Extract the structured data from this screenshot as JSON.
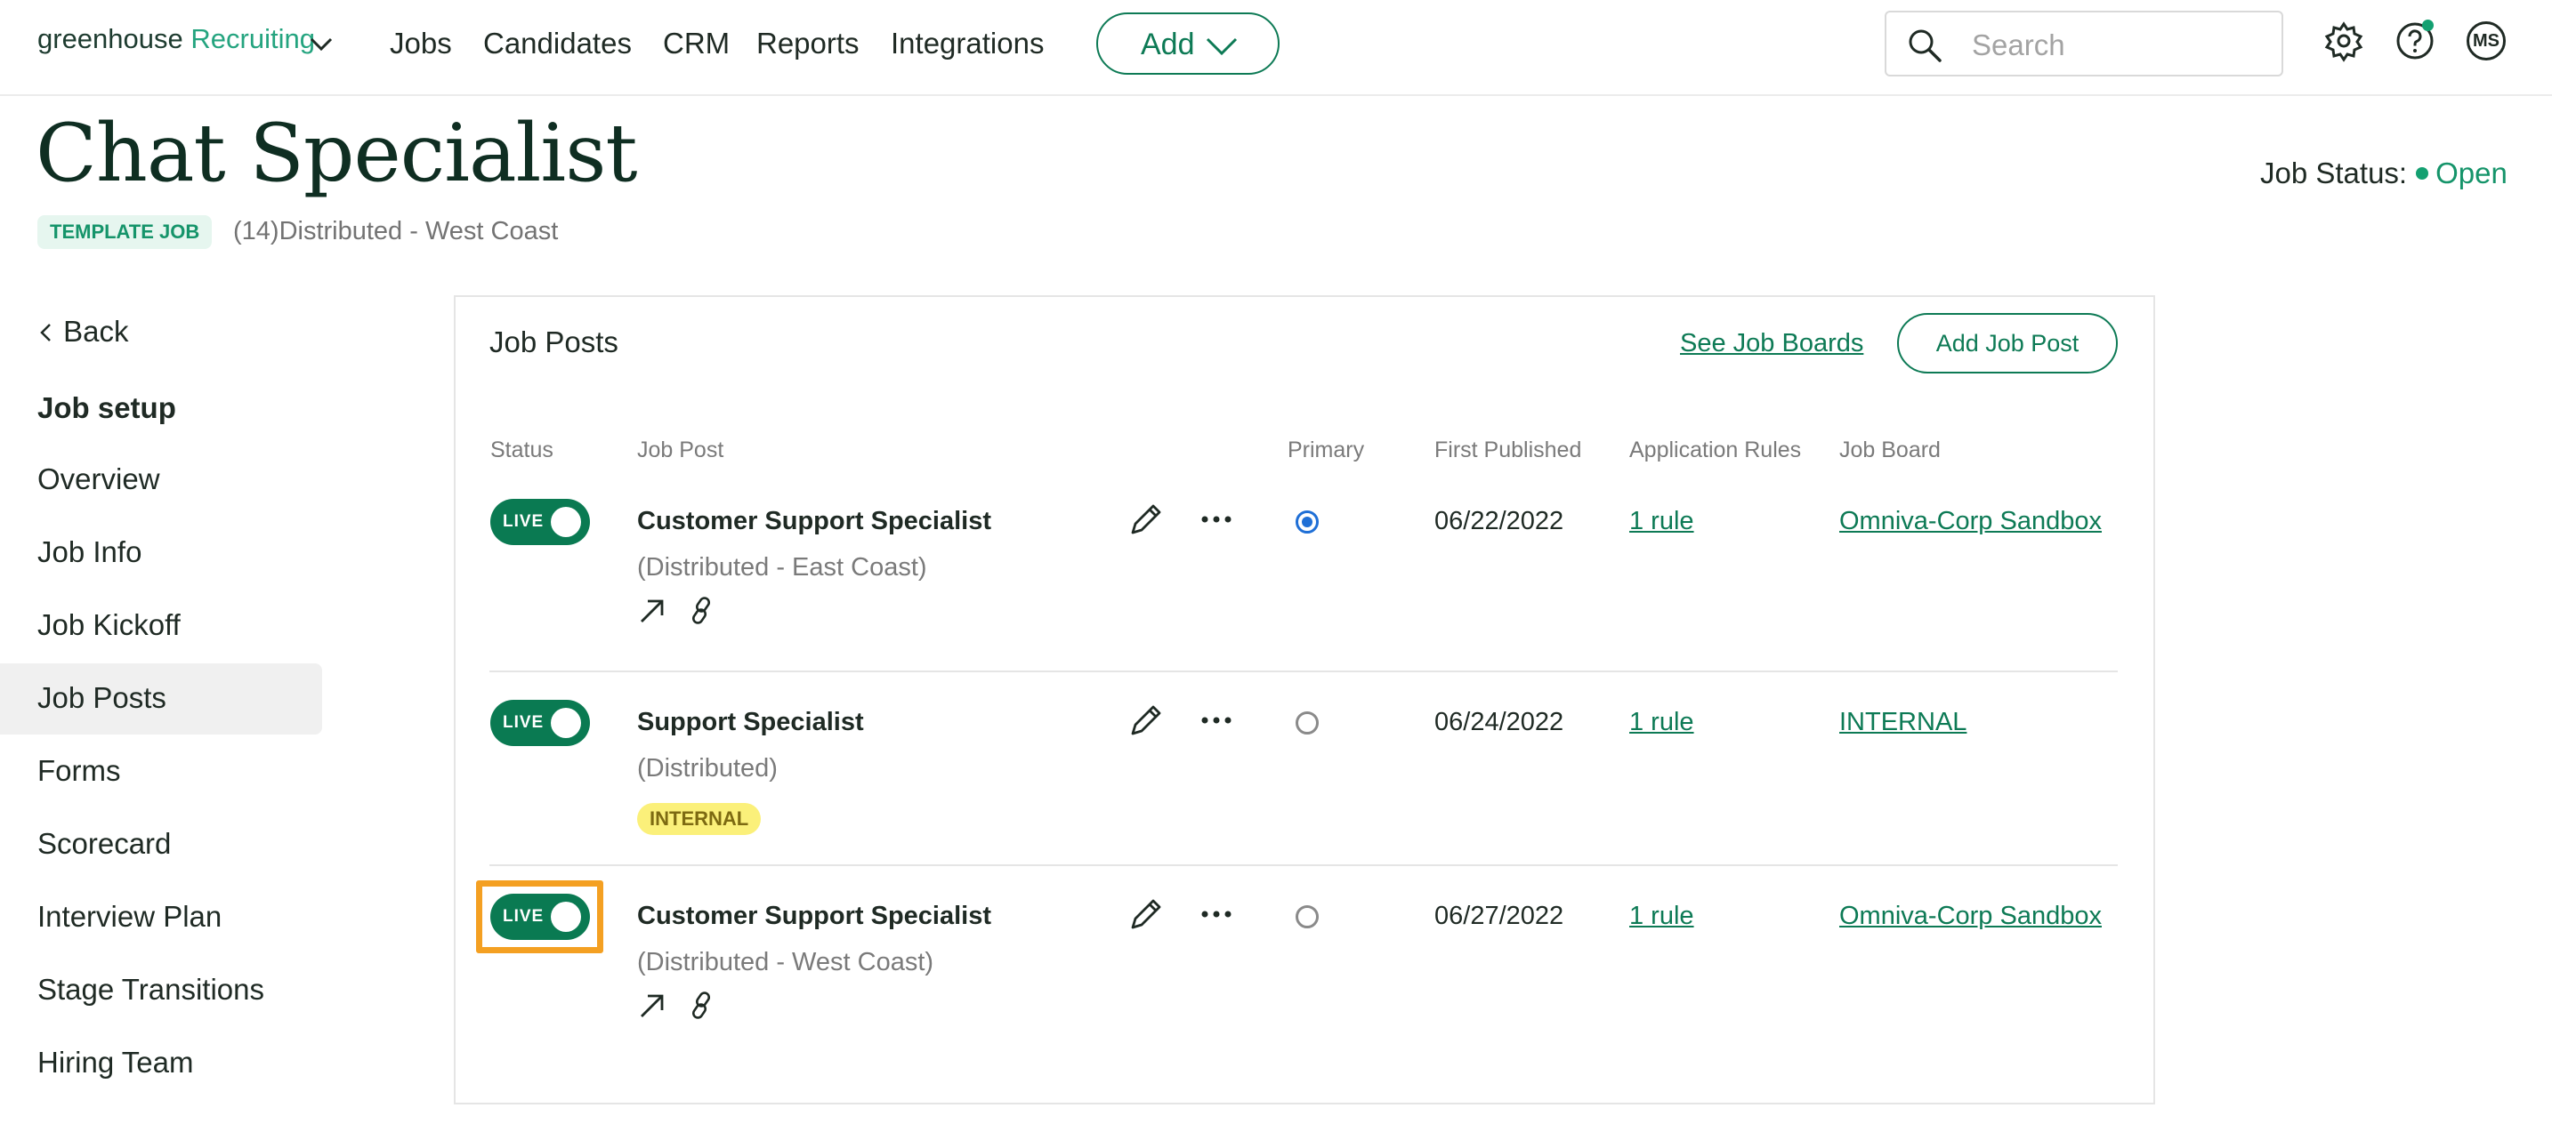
{
  "nav": {
    "logo_main": "greenhouse",
    "logo_accent": "Recruiting",
    "links": [
      "Jobs",
      "Candidates",
      "CRM",
      "Reports",
      "Integrations"
    ],
    "add_label": "Add",
    "search_placeholder": "Search",
    "avatar_initials": "MS"
  },
  "header": {
    "title": "Chat Specialist",
    "template_badge": "TEMPLATE JOB",
    "meta": "(14)Distributed - West Coast",
    "status_label": "Job Status:",
    "status_value": "Open"
  },
  "sidebar": {
    "back_label": "Back",
    "section_title": "Job setup",
    "items": [
      "Overview",
      "Job Info",
      "Job Kickoff",
      "Job Posts",
      "Forms",
      "Scorecard",
      "Interview Plan",
      "Stage Transitions",
      "Hiring Team"
    ],
    "active_item": "Job Posts"
  },
  "panel": {
    "title": "Job Posts",
    "see_boards": "See Job Boards",
    "add_post": "Add Job Post",
    "columns": {
      "status": "Status",
      "job_post": "Job Post",
      "primary": "Primary",
      "first_published": "First Published",
      "application_rules": "Application Rules",
      "job_board": "Job Board"
    },
    "rows": [
      {
        "status": "LIVE",
        "title": "Customer Support Specialist",
        "location": "(Distributed - East Coast)",
        "badge": "",
        "primary": true,
        "first_published": "06/22/2022",
        "rules": "1 rule",
        "board": "Omniva-Corp Sandbox"
      },
      {
        "status": "LIVE",
        "title": "Support Specialist",
        "location": "(Distributed)",
        "badge": "INTERNAL",
        "primary": false,
        "first_published": "06/24/2022",
        "rules": "1 rule",
        "board": "INTERNAL"
      },
      {
        "status": "LIVE",
        "title": "Customer Support Specialist",
        "location": "(Distributed - West Coast)",
        "badge": "",
        "primary": false,
        "first_published": "06/27/2022",
        "rules": "1 rule",
        "board": "Omniva-Corp Sandbox"
      }
    ]
  },
  "colors": {
    "brand_green": "#0d7a55",
    "toggle_green": "#0a7a52",
    "highlight_orange": "#f4a022",
    "radio_blue": "#1f6fd6",
    "internal_yellow": "#fbf07a"
  }
}
